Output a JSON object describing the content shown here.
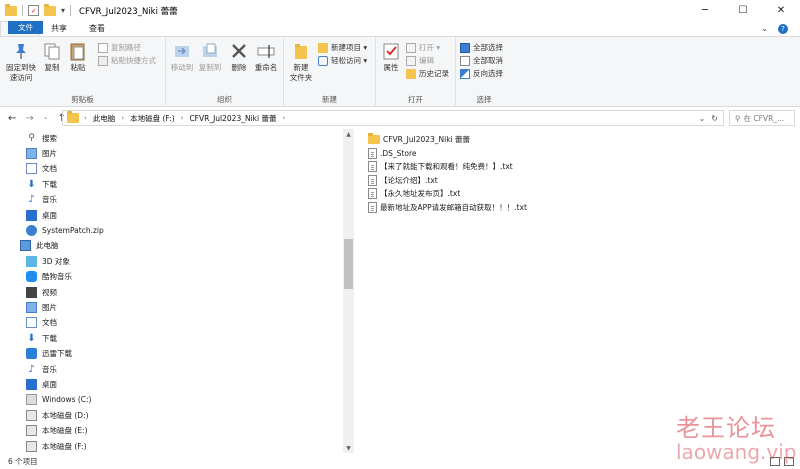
{
  "window": {
    "title": "CFVR_Jul2023_Niki 蕾蕾",
    "controls": [
      "─",
      "☐",
      "✕"
    ]
  },
  "ribbon_tabs": {
    "file": "文件",
    "home": "主页",
    "share": "共享",
    "view": "查看"
  },
  "ribbon": {
    "clipboard": {
      "label": "剪贴板",
      "pin": "固定到快\n速访问",
      "copy": "复制",
      "paste": "粘贴",
      "copy_path": "复制路径",
      "paste_shortcut": "粘贴快捷方式"
    },
    "organize": {
      "label": "组织",
      "move_to": "移动到",
      "copy_to": "复制到",
      "delete": "删除",
      "rename": "重命名"
    },
    "new": {
      "label": "新建",
      "new_folder": "新建\n文件夹",
      "new_item": "新建项目 ▾",
      "easy_access": "轻松访问 ▾"
    },
    "open": {
      "label": "打开",
      "properties": "属性",
      "open": "打开 ▾",
      "edit": "编辑",
      "history": "历史记录"
    },
    "select": {
      "label": "选择",
      "select_all": "全部选择",
      "select_none": "全部取消",
      "invert": "反向选择"
    }
  },
  "address": {
    "crumbs": [
      "此电脑",
      "本地磁盘 (F:)",
      "CFVR_Jul2023_Niki 蕾蕾"
    ],
    "search_placeholder": "在 CFVR_..."
  },
  "nav_pane": [
    {
      "label": "搜索",
      "icon": "search-icon"
    },
    {
      "label": "图片",
      "icon": "pictures-icon"
    },
    {
      "label": "文档",
      "icon": "documents-icon"
    },
    {
      "label": "下载",
      "icon": "downloads-icon"
    },
    {
      "label": "音乐",
      "icon": "music-icon"
    },
    {
      "label": "桌面",
      "icon": "desktop-icon"
    },
    {
      "label": "SystemPatch.zip",
      "icon": "zip-icon"
    },
    {
      "label": "此电脑",
      "icon": "this-pc-icon"
    },
    {
      "label": "3D 对象",
      "icon": "3d-objects-icon"
    },
    {
      "label": "酷狗音乐",
      "icon": "kugou-icon"
    },
    {
      "label": "视频",
      "icon": "videos-icon"
    },
    {
      "label": "图片",
      "icon": "pictures-icon"
    },
    {
      "label": "文档",
      "icon": "documents-icon"
    },
    {
      "label": "下载",
      "icon": "downloads-icon"
    },
    {
      "label": "迅雷下载",
      "icon": "thunder-icon"
    },
    {
      "label": "音乐",
      "icon": "music-icon"
    },
    {
      "label": "桌面",
      "icon": "desktop-icon"
    },
    {
      "label": "Windows (C:)",
      "icon": "drive-c-icon"
    },
    {
      "label": "本地磁盘 (D:)",
      "icon": "drive-icon"
    },
    {
      "label": "本地磁盘 (E:)",
      "icon": "drive-icon"
    },
    {
      "label": "本地磁盘 (F:)",
      "icon": "drive-icon"
    }
  ],
  "files": [
    {
      "name": "CFVR_Jul2023_Niki 蕾蕾",
      "type": "folder"
    },
    {
      "name": ".DS_Store",
      "type": "file"
    },
    {
      "name": "【来了就能下载和观看！纯免费！】.txt",
      "type": "txt"
    },
    {
      "name": "【论坛介绍】.txt",
      "type": "txt"
    },
    {
      "name": "【永久地址发布页】.txt",
      "type": "txt"
    },
    {
      "name": "最新地址及APP请发邮箱自动获取！！！.txt",
      "type": "txt"
    }
  ],
  "status": {
    "count": "6 个项目"
  },
  "watermark": {
    "line1": "老王论坛",
    "line2": "laowang.vip"
  },
  "colors": {
    "accent": "#1f6fc5",
    "folder": "#f4c44e",
    "watermark": "#d63c46"
  }
}
